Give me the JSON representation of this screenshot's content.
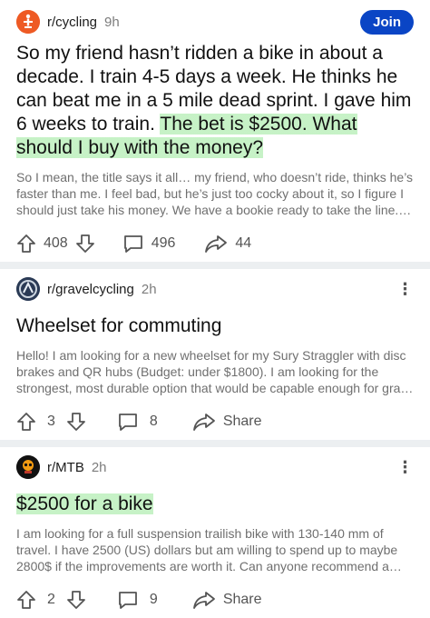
{
  "posts": [
    {
      "subreddit": "r/cycling",
      "age": "9h",
      "join_label": "Join",
      "title_plain": "So my friend hasn’t ridden a bike in about a decade. I train 4-5 days a week. He thinks he can beat me in a 5 mile dead sprint. I gave him 6 weeks to train.",
      "title_highlight": "The bet is $2500. What should I buy with the money?",
      "body": "So I mean, the title says it all… my friend, who doesn’t ride, thinks he’s faster than me. I feel bad, but he’s just too cocky about it, so I figure I should just take his money.  We have a bookie ready to take the line. …",
      "upvotes": "408",
      "comments": "496",
      "shares": "44",
      "avatar_icon": "cycling-subreddit-icon"
    },
    {
      "subreddit": "r/gravelcycling",
      "age": "2h",
      "more_label": "⋮",
      "title": "Wheelset for commuting",
      "body": "Hello! I am looking for a new wheelset for my Sury Straggler with disc brakes and QR hubs (Budget: under $1800). I am looking for the strongest, most durable option that would be capable enough for gra…",
      "upvotes": "3",
      "comments": "8",
      "share_label": "Share",
      "avatar_icon": "gravelcycling-subreddit-icon"
    },
    {
      "subreddit": "r/MTB",
      "age": "2h",
      "more_label": "⋮",
      "title": "$2500 for a bike",
      "body": "I am looking for a full suspension trailish bike with 130-140 mm of travel. I have 2500 (US) dollars but am willing to spend up to maybe 2800$ if the improvements are worth it. Can anyone recommend a bi…",
      "upvotes": "2",
      "comments": "9",
      "share_label": "Share",
      "avatar_icon": "mtb-subreddit-icon"
    }
  ],
  "colors": {
    "join_button": "#0a45c5",
    "highlight": "#8ce68c",
    "divider": "#eceff1",
    "muted_text": "#6f6f6f"
  }
}
